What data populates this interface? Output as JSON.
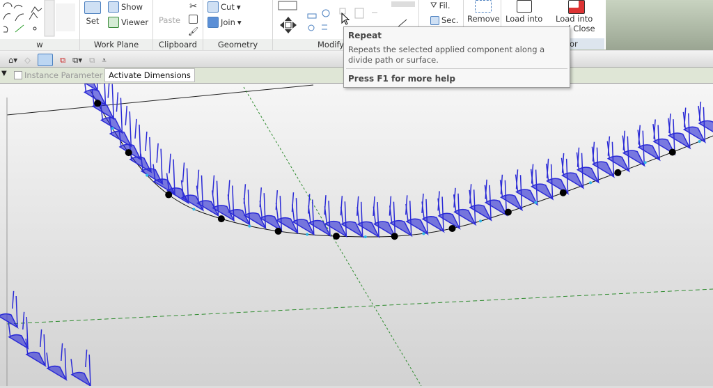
{
  "ribbon": {
    "panels": [
      {
        "label": "w"
      },
      {
        "label": "Work Plane",
        "buttons": [
          "Set",
          "Show",
          "Viewer"
        ]
      },
      {
        "label": "Clipboard",
        "buttons": [
          "Paste"
        ]
      },
      {
        "label": "Geometry",
        "buttons": [
          "Cut",
          "Join"
        ]
      },
      {
        "label": "Modify"
      },
      {
        "label": "or"
      }
    ],
    "other_buttons": {
      "filter": "Fil.",
      "section": "Sec.",
      "remove": "Remove",
      "load_into": "Load into",
      "load_into_close_1": "Load into",
      "load_into_close_2": "and Close"
    }
  },
  "options_bar": {
    "instance_parameter": "Instance Parameter",
    "instance_parameter_checked": false,
    "activate_dimensions": "Activate Dimensions"
  },
  "tooltip": {
    "title": "Repeat",
    "description": "Repeats the selected applied component along a divide path or surface.",
    "help": "Press F1 for more help"
  },
  "colors": {
    "component": "#2a2ad6",
    "ref_plane": "#2e8b2e",
    "node": "#000000",
    "point": "#2fb6e6"
  }
}
